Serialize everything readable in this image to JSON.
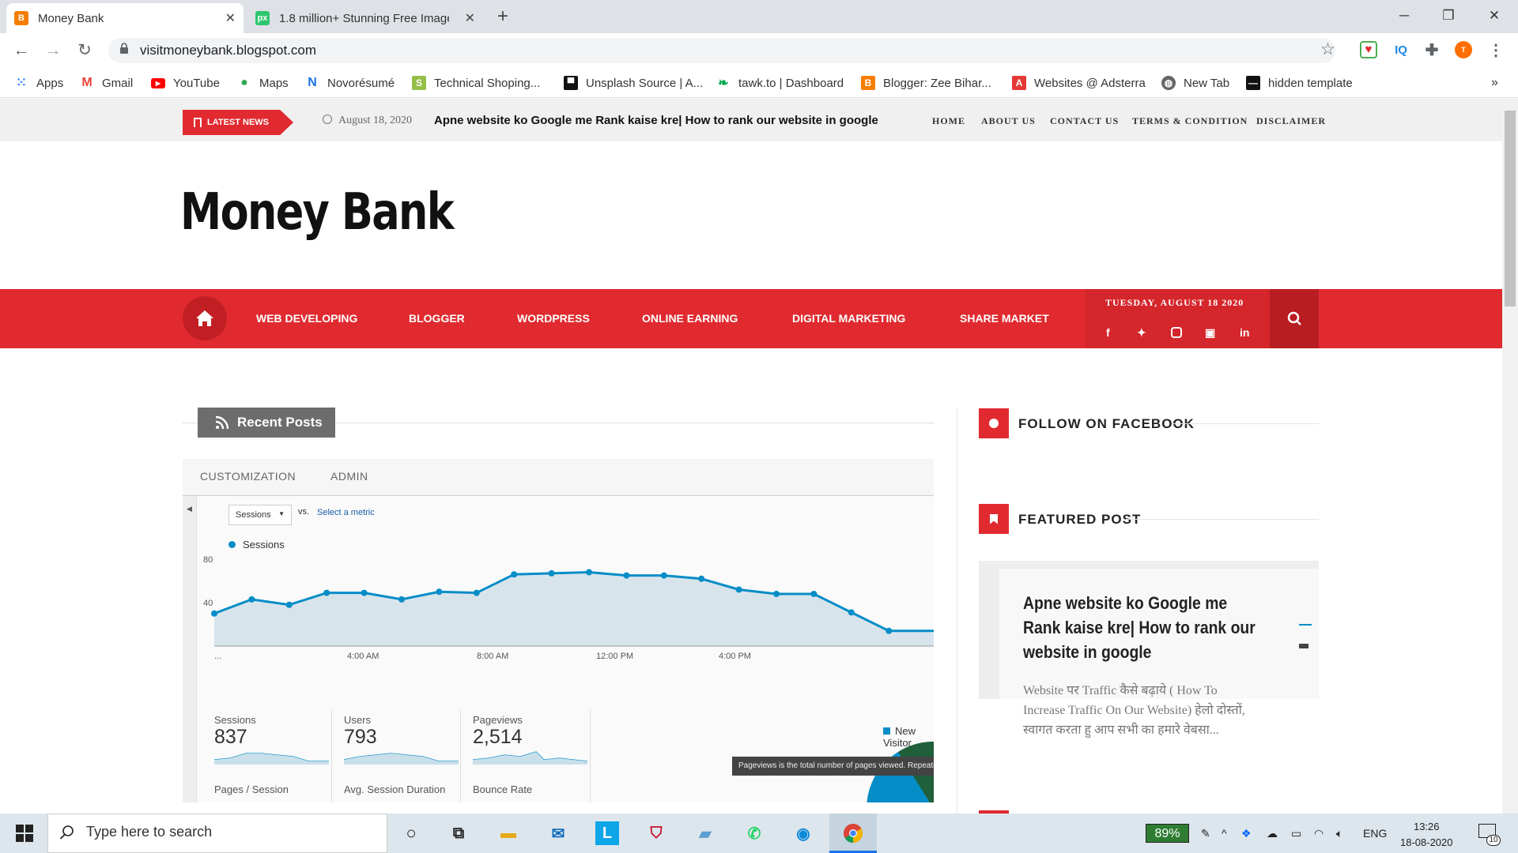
{
  "browser": {
    "tabs": [
      {
        "title": "Money Bank",
        "icon": "blogger-icon"
      },
      {
        "title": "1.8 million+ Stunning Free Images",
        "icon": "pixabay-icon"
      }
    ],
    "url": "visitmoneybank.blogspot.com",
    "extensions": [
      "IQ"
    ],
    "bookmarks": [
      "Apps",
      "Gmail",
      "YouTube",
      "Maps",
      "Novorésumé",
      "Technical Shoping...",
      "Unsplash Source | A...",
      "tawk.to | Dashboard",
      "Blogger: Zee Bihar...",
      "Websites @ Adsterra",
      "New Tab",
      "hidden template"
    ],
    "overflow": "»"
  },
  "site": {
    "latest_label": "LATEST NEWS",
    "news_date": "August 18, 2020",
    "news_title": "Apne website ko Google me Rank kaise kre| How to rank our website in google",
    "top_nav": [
      "HOME",
      "ABOUT US",
      "CONTACT US",
      "TERMS & CONDITION",
      "DISCLAIMER"
    ],
    "logo": "Money Bank",
    "menu": [
      "WEB DEVELOPING",
      "BLOGGER",
      "WORDPRESS",
      "ONLINE EARNING",
      "DIGITAL MARKETING",
      "SHARE MARKET"
    ],
    "date": "TUESDAY, AUGUST 18 2020",
    "recent_posts": "Recent Posts",
    "sidebar": {
      "follow": "FOLLOW ON FACEBOOK",
      "featured": "FEATURED POST",
      "featured_title": "Apne website ko Google me Rank kaise kre| How to rank our website in google",
      "featured_excerpt": "Website पर Traffic कैसे बढ़ाये  ( How To Increase Traffic On Our Website)  हेलो दोस्तों,      स्वागत करता हु आप सभी का हमारे वेबसा..."
    }
  },
  "screenshot": {
    "tabs": [
      "CUSTOMIZATION",
      "ADMIN"
    ],
    "metric_select": "Sessions",
    "vs": "vs.",
    "select_metric": "Select a metric",
    "legend": "Sessions",
    "new_visitor": "New Visitor",
    "metrics": [
      {
        "label": "Sessions",
        "value": "837"
      },
      {
        "label": "Users",
        "value": "793"
      },
      {
        "label": "Pageviews",
        "value": "2,514"
      }
    ],
    "metrics_row2": [
      "Pages / Session",
      "Avg. Session Duration",
      "Bounce Rate"
    ],
    "tooltip": "Pageviews is the total number of pages viewed. Repeated views"
  },
  "chart_data": {
    "type": "line",
    "title": "",
    "series": [
      {
        "name": "Sessions",
        "values": [
          30,
          43,
          38,
          49,
          49,
          43,
          50,
          49,
          66,
          67,
          68,
          65,
          65,
          62,
          52,
          48,
          48,
          31,
          14
        ]
      }
    ],
    "x_ticks": [
      "...",
      "4:00 AM",
      "8:00 AM",
      "12:00 PM",
      "4:00 PM"
    ],
    "y_ticks": [
      "80",
      "40"
    ],
    "ylim": [
      0,
      80
    ],
    "grid": false,
    "color": "#058dc7"
  },
  "taskbar": {
    "search_placeholder": "Type here to search",
    "battery": "89%",
    "lang": "ENG",
    "time": "13:26",
    "date": "18-08-2020",
    "notifications": "10"
  }
}
